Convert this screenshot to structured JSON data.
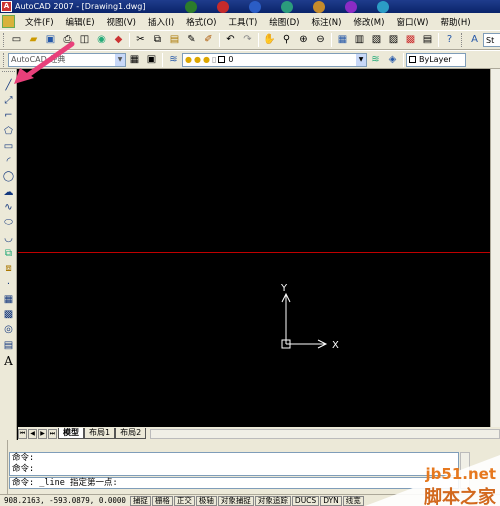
{
  "window": {
    "title": "AutoCAD 2007 - [Drawing1.dwg]",
    "app_icon_text": "A"
  },
  "menu": {
    "items": [
      "文件(F)",
      "编辑(E)",
      "视图(V)",
      "插入(I)",
      "格式(O)",
      "工具(T)",
      "绘图(D)",
      "标注(N)",
      "修改(M)",
      "窗口(W)",
      "帮助(H)"
    ]
  },
  "toolbar_styles": {
    "workspace_value": "AutoCAD 经典",
    "style_combo_value": "St",
    "layer_value": "0",
    "color_value": "ByLayer"
  },
  "draw_tools": [
    {
      "icon": "line-icon"
    },
    {
      "icon": "construction-line-icon"
    },
    {
      "icon": "polyline-icon"
    },
    {
      "icon": "polygon-icon"
    },
    {
      "icon": "rectangle-icon"
    },
    {
      "icon": "arc-icon"
    },
    {
      "icon": "circle-icon"
    },
    {
      "icon": "revision-cloud-icon"
    },
    {
      "icon": "spline-icon"
    },
    {
      "icon": "ellipse-icon"
    },
    {
      "icon": "ellipse-arc-icon"
    },
    {
      "icon": "insert-block-icon"
    },
    {
      "icon": "make-block-icon"
    },
    {
      "icon": "point-icon"
    },
    {
      "icon": "hatch-icon"
    },
    {
      "icon": "gradient-icon"
    },
    {
      "icon": "region-icon"
    },
    {
      "icon": "table-icon"
    },
    {
      "icon": "multiline-text-icon",
      "label": "A"
    }
  ],
  "ucs": {
    "x_label": "X",
    "y_label": "Y"
  },
  "layout_tabs": {
    "model": "模型",
    "layout1": "布局1",
    "layout2": "布局2"
  },
  "command": {
    "history": [
      "命令:",
      "命令:"
    ],
    "current": "命令: _line 指定第一点:"
  },
  "status": {
    "coordinates": "908.2163, -593.0879, 0.0000",
    "buttons": [
      "捕捉",
      "栅格",
      "正交",
      "极轴",
      "对象捕捉",
      "对象追踪",
      "DUCS",
      "DYN",
      "线宽"
    ]
  },
  "watermark": {
    "url": "jb51.net",
    "name": "脚本之家"
  },
  "colors": {
    "crosshair": "#c00000",
    "canvas": "#000000",
    "annotation_arrow": "#e8407a"
  }
}
